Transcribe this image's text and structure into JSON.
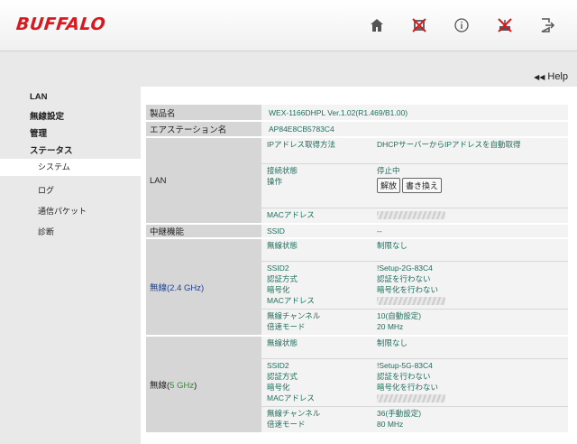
{
  "brand": "BUFFALO",
  "header_icons": [
    "home-icon",
    "wired-disabled-icon",
    "info-icon",
    "wireless-disabled-icon",
    "logout-icon"
  ],
  "help": {
    "label": "Help"
  },
  "sidebar": {
    "items": [
      {
        "label": "LAN"
      },
      {
        "label": "無線設定"
      },
      {
        "label": "管理"
      },
      {
        "label": "ステータス"
      }
    ],
    "sub_items": [
      {
        "label": "システム"
      },
      {
        "label": "ログ"
      },
      {
        "label": "通信パケット"
      },
      {
        "label": "診断"
      }
    ]
  },
  "status": {
    "product": {
      "label": "製品名",
      "value": "WEX-1166DHPL Ver.1.02(R1.469/B1.00)"
    },
    "airstation": {
      "label": "エアステーション名",
      "value": "AP84E8CB5783C4"
    },
    "lan": {
      "label": "LAN",
      "ip_method_key": "IPアドレス取得方法",
      "ip_method_val": "DHCPサーバーからIPアドレスを自動取得",
      "conn_key": "接続状態",
      "conn_val": "停止中",
      "op_key": "操作",
      "release_btn": "解放",
      "renew_btn": "書き換え",
      "mac_key": "MACアドレス"
    },
    "relay": {
      "label": "中継機能",
      "ssid_key": "SSID",
      "ssid_val": "--"
    },
    "w24": {
      "label_prefix": "無線(",
      "label_band": "2.4 GHz",
      "label_suffix": ")",
      "state_key": "無線状態",
      "state_val": "制限なし",
      "ssid_key": "SSID2",
      "ssid_val": "!Setup-2G-83C4",
      "auth_key": "認証方式",
      "auth_val": "認証を行わない",
      "enc_key": "暗号化",
      "enc_val": "暗号化を行わない",
      "mac_key": "MACアドレス",
      "ch_key": "無線チャンネル",
      "ch_val": "10(自動設定)",
      "mode_key": "倍速モード",
      "mode_val": "20 MHz"
    },
    "w5": {
      "label_prefix": "無線(",
      "label_band": "5 GHz",
      "label_suffix": ")",
      "state_key": "無線状態",
      "state_val": "制限なし",
      "ssid_key": "SSID2",
      "ssid_val": "!Setup-5G-83C4",
      "auth_key": "認証方式",
      "auth_val": "認証を行わない",
      "enc_key": "暗号化",
      "enc_val": "暗号化を行わない",
      "mac_key": "MACアドレス",
      "ch_key": "無線チャンネル",
      "ch_val": "36(手動設定)",
      "mode_key": "倍速モード",
      "mode_val": "80 MHz"
    }
  },
  "colors": {
    "brand": "#d71920",
    "value_text": "#1f6e5c",
    "band_24": "#1f3f8f",
    "band_5": "#2f8b2f"
  }
}
